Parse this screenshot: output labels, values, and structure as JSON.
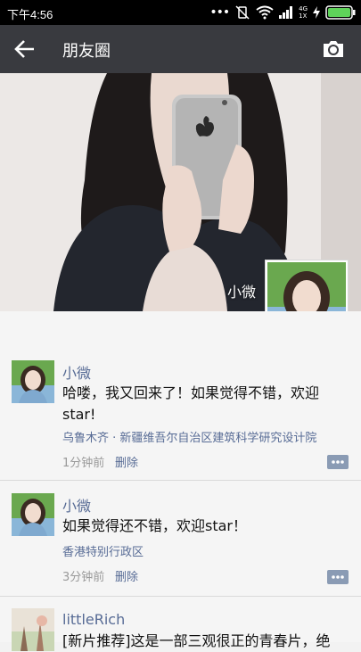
{
  "status": {
    "time": "下午4:56",
    "net": "4G",
    "net_sub": "1X"
  },
  "nav": {
    "title": "朋友圈",
    "back_icon": "back-arrow-icon",
    "camera_icon": "camera-icon"
  },
  "cover": {
    "username": "小微"
  },
  "posts": [
    {
      "name": "小微",
      "content": "哈喽，我又回来了！如果觉得不错，欢迎star!",
      "location": "乌鲁木齐 · 新疆维吾尔自治区建筑科学研究设计院",
      "time": "1分钟前",
      "delete": "删除"
    },
    {
      "name": "小微",
      "content": "如果觉得还不错，欢迎star！",
      "location": "香港特别行政区",
      "time": "3分钟前",
      "delete": "删除"
    },
    {
      "name": "littleRich",
      "content": "[新片推荐]这是一部三观很正的青春片，绝"
    }
  ],
  "colors": {
    "navbar": "#393a3f",
    "link": "#576b95",
    "statusbar": "#000000"
  }
}
